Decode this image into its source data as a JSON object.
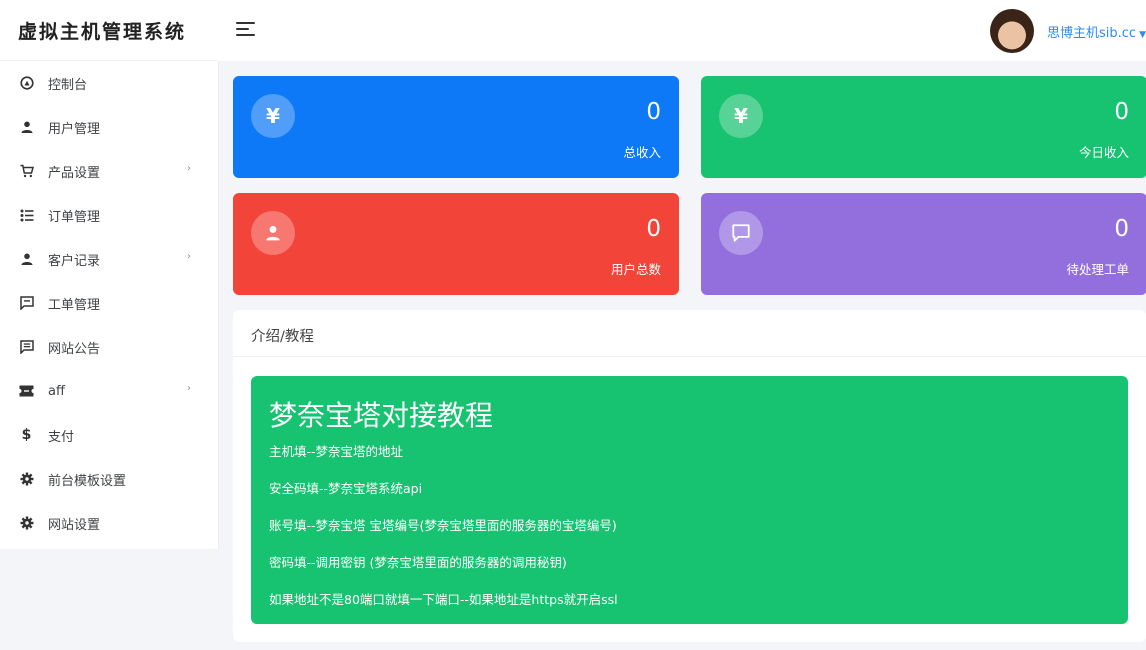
{
  "brand": {
    "title": "虚拟主机管理系统"
  },
  "sidebar": {
    "items": [
      {
        "label": "控制台",
        "icon": "dashboard-icon"
      },
      {
        "label": "用户管理",
        "icon": "user-icon"
      },
      {
        "label": "产品设置",
        "icon": "cart-icon",
        "expandable": true
      },
      {
        "label": "订单管理",
        "icon": "list-icon"
      },
      {
        "label": "客户记录",
        "icon": "user-icon",
        "expandable": true
      },
      {
        "label": "工单管理",
        "icon": "message-icon"
      },
      {
        "label": "网站公告",
        "icon": "announcement-icon"
      },
      {
        "label": "aff",
        "icon": "ticket-icon",
        "expandable": true
      },
      {
        "label": "支付",
        "icon": "dollar-icon"
      },
      {
        "label": "前台模板设置",
        "icon": "gear-icon"
      },
      {
        "label": "网站设置",
        "icon": "gear-icon"
      }
    ]
  },
  "header": {
    "user_name": "思博主机sib.cc"
  },
  "stats": [
    {
      "value": "0",
      "label": "总收入",
      "icon": "yen-icon",
      "color": "#0d79f7"
    },
    {
      "value": "0",
      "label": "今日收入",
      "icon": "yen-icon",
      "color": "#17c271"
    },
    {
      "value": "0",
      "label": "用户总数",
      "icon": "user-icon",
      "color": "#f3443a"
    },
    {
      "value": "0",
      "label": "待处理工单",
      "icon": "message-icon",
      "color": "#936fde"
    }
  ],
  "panel": {
    "title": "介绍/教程",
    "tutorial_title": "梦奈宝塔对接教程",
    "lines": [
      "主机填--梦奈宝塔的地址",
      "安全码填--梦奈宝塔系统api",
      "账号填--梦奈宝塔 宝塔编号(梦奈宝塔里面的服务器的宝塔编号)",
      "密码填--调用密钥 (梦奈宝塔里面的服务器的调用秘钥)",
      "如果地址不是80端口就填一下端口--如果地址是https就开启ssl"
    ]
  }
}
